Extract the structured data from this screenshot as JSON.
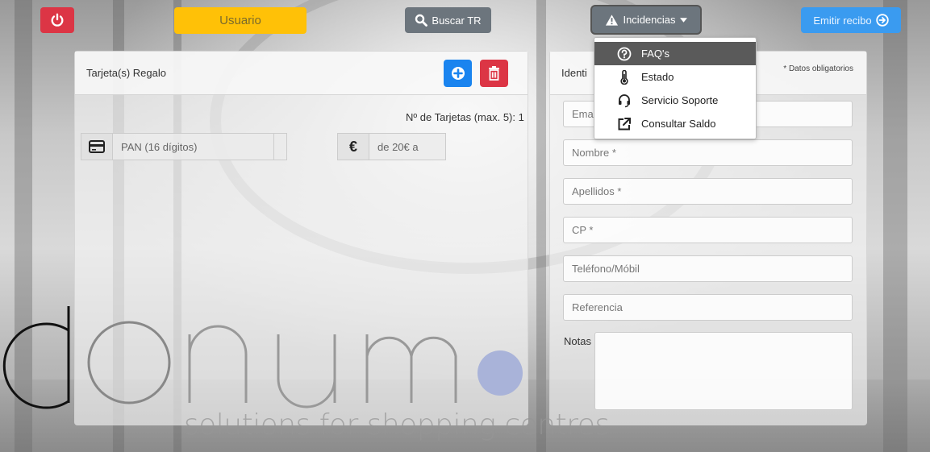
{
  "topbar": {
    "user_label": "Usuario",
    "search_label": "Buscar TR",
    "incidents_label": "Incidencias",
    "emit_label": "Emitir recibo"
  },
  "gift_panel": {
    "title": "Tarjeta(s) Regalo",
    "count_label": "Nº de Tarjetas (max. 5): 1",
    "pan_placeholder": "PAN (16 dígitos)",
    "amount_placeholder": "de 20€ a",
    "euro_symbol": "€"
  },
  "ident_panel": {
    "title": "Identi",
    "required_note": "* Datos obligatorios",
    "email_placeholder": "Ema",
    "name_placeholder": "Nombre *",
    "surname_placeholder": "Apellidos *",
    "cp_placeholder": "CP *",
    "phone_placeholder": "Teléfono/Móbil",
    "reference_placeholder": "Referencia",
    "notes_label": "Notas"
  },
  "dropdown": {
    "items": [
      {
        "label": "FAQ's",
        "icon": "question-circle-icon",
        "active": true
      },
      {
        "label": "Estado",
        "icon": "thermometer-icon",
        "active": false
      },
      {
        "label": "Servicio Soporte",
        "icon": "headset-icon",
        "active": false
      },
      {
        "label": "Consultar Saldo",
        "icon": "external-link-icon",
        "active": false
      }
    ]
  },
  "branding": {
    "wordmark": "donum",
    "tagline": "solutions for shopping centres"
  },
  "colors": {
    "danger": "#dc3545",
    "warning": "#ffc107",
    "secondary": "#6c757d",
    "primary": "#1a84ef",
    "emit": "#3a9bf0",
    "logo_dot": "#a9b3d9"
  }
}
